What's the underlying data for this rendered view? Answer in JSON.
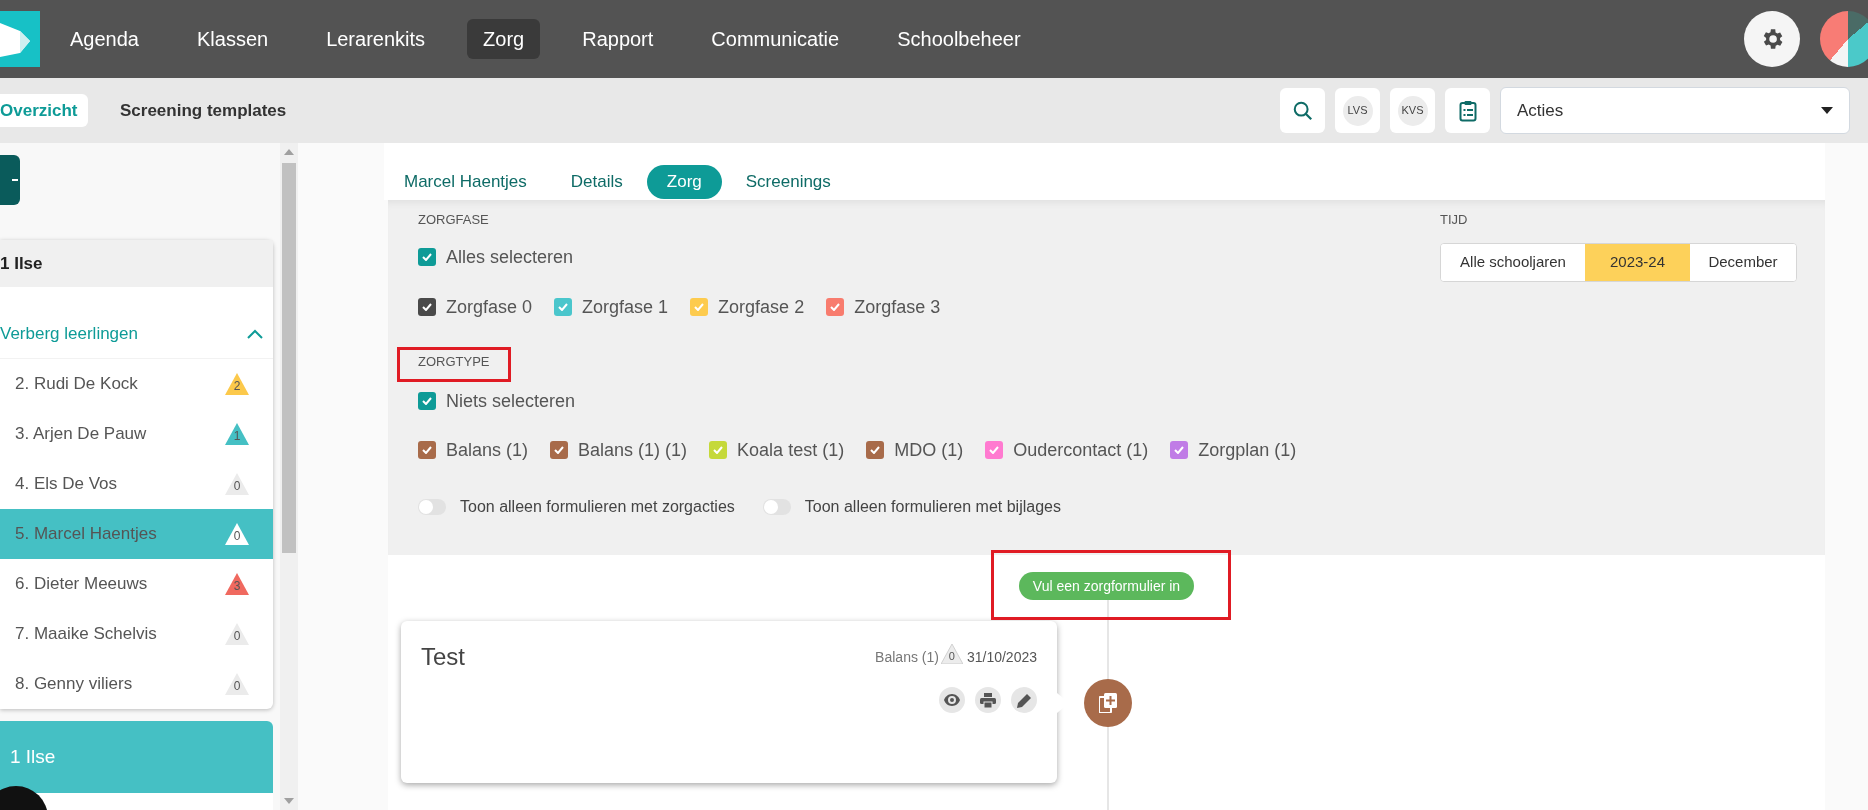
{
  "nav": {
    "items": [
      {
        "label": "Agenda",
        "selected": false
      },
      {
        "label": "Klassen",
        "selected": false
      },
      {
        "label": "Lerarenkits",
        "selected": false
      },
      {
        "label": "Zorg",
        "selected": true
      },
      {
        "label": "Rapport",
        "selected": false
      },
      {
        "label": "Communicatie",
        "selected": false
      },
      {
        "label": "Schoolbeheer",
        "selected": false
      }
    ]
  },
  "subnav": {
    "tabs": [
      {
        "label": "Overzicht",
        "selected": true
      },
      {
        "label": "Screening templates",
        "selected": false
      }
    ]
  },
  "toolbar": {
    "badges": [
      "LVS",
      "KVS"
    ],
    "actions_dropdown": {
      "value": "Acties"
    }
  },
  "sidebar": {
    "group": {
      "title": "1 Ilse",
      "toggle_label": "Verberg leerlingen",
      "expanded": true,
      "students": [
        {
          "name": "2. Rudi De Kock",
          "count": "2",
          "color": "#fcc94b",
          "selected": false
        },
        {
          "name": "3. Arjen De Pauw",
          "count": "1",
          "color": "#45c0c4",
          "selected": false
        },
        {
          "name": "4. Els De Vos",
          "count": "0",
          "color": "#ebebeb",
          "selected": false
        },
        {
          "name": "5. Marcel Haentjes",
          "count": "0",
          "color": "#ffffff",
          "selected": true
        },
        {
          "name": "6. Dieter Meeuws",
          "count": "3",
          "color": "#f0695f",
          "selected": false
        },
        {
          "name": "7. Maaike Schelvis",
          "count": "0",
          "color": "#ebebeb",
          "selected": false
        },
        {
          "name": "8. Genny viliers",
          "count": "0",
          "color": "#ebebeb",
          "selected": false
        }
      ]
    },
    "next_group": {
      "title": "1 Ilse"
    }
  },
  "student_tabs": [
    {
      "label": "Marcel Haentjes",
      "selected": false
    },
    {
      "label": "Details",
      "selected": false
    },
    {
      "label": "Zorg",
      "selected": true
    },
    {
      "label": "Screenings",
      "selected": false
    }
  ],
  "filters": {
    "zorgfase": {
      "label": "ZORGFASE",
      "select_all": {
        "label": "Alles selecteren",
        "checked": true
      },
      "options": [
        {
          "label": "Zorgfase 0",
          "checked": true,
          "color": "#4a4a4a"
        },
        {
          "label": "Zorgfase 1",
          "checked": true,
          "color": "#4ac6cc"
        },
        {
          "label": "Zorgfase 2",
          "checked": true,
          "color": "#fdcb4e"
        },
        {
          "label": "Zorgfase 3",
          "checked": true,
          "color": "#f87c6e"
        }
      ]
    },
    "zorgtype": {
      "label": "ZORGTYPE",
      "select_all": {
        "label": "Niets selecteren",
        "checked": true
      },
      "options": [
        {
          "label": "Balans (1)",
          "checked": true,
          "color": "#a86b4a"
        },
        {
          "label": "Balans (1) (1)",
          "checked": true,
          "color": "#a86b4a"
        },
        {
          "label": "Koala test (1)",
          "checked": true,
          "color": "#c5d93a"
        },
        {
          "label": "MDO (1)",
          "checked": true,
          "color": "#a86b4a"
        },
        {
          "label": "Oudercontact (1)",
          "checked": true,
          "color": "#ff7ad0"
        },
        {
          "label": "Zorgplan (1)",
          "checked": true,
          "color": "#c07ce6"
        }
      ]
    },
    "toggles": [
      {
        "label": "Toon alleen formulieren met zorgacties",
        "on": false
      },
      {
        "label": "Toon alleen formulieren met bijlages",
        "on": false
      }
    ],
    "tijd": {
      "label": "TIJD",
      "segments": [
        {
          "label": "Alle schooljaren",
          "selected": false
        },
        {
          "label": "2023-24",
          "selected": true
        },
        {
          "label": "December",
          "selected": false
        }
      ]
    }
  },
  "add_form_button": "Vul een zorgformulier in",
  "timeline": [
    {
      "title": "Test",
      "type": "Balans (1)",
      "count": "0",
      "date": "31/10/2023",
      "color": "#a86b4a"
    }
  ]
}
